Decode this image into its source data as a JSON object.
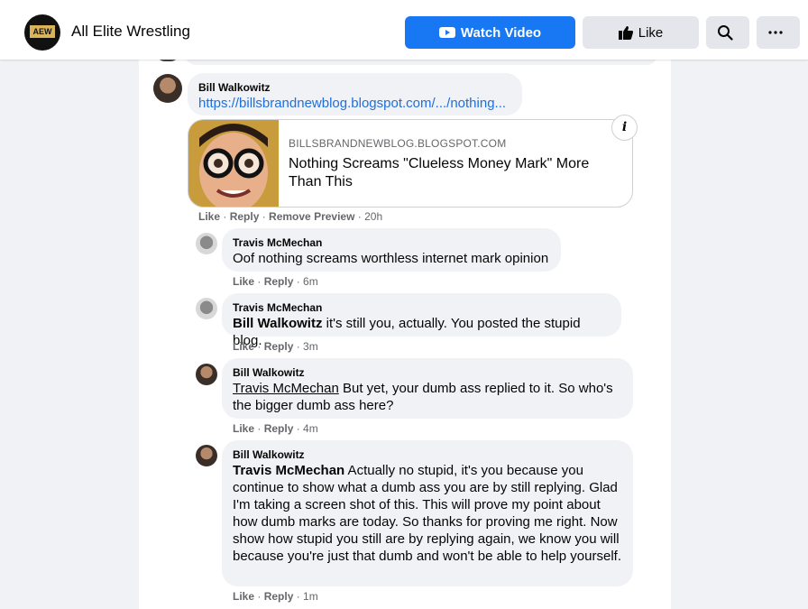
{
  "header": {
    "page_name": "All Elite Wrestling",
    "logo_text": "AEW",
    "watch_label": "Watch Video",
    "like_label": "Like",
    "icons": {
      "watch": "video-icon",
      "like": "thumbs-up-icon",
      "search": "search-icon",
      "more": "more-icon"
    }
  },
  "comments": [
    {
      "author": "Bill Walkowitz",
      "link": "https://billsbrandnewblog.blogspot.com/.../nothing...",
      "preview": {
        "domain": "BILLSBRANDNEWBLOG.BLOGSPOT.COM",
        "title": "Nothing Screams \"Clueless Money Mark\" More Than This"
      },
      "actions": {
        "like": "Like",
        "reply": "Reply",
        "remove": "Remove Preview",
        "time": "20h"
      }
    },
    {
      "author": "Travis McMechan",
      "text": "Oof nothing screams worthless internet mark opinion",
      "actions": {
        "like": "Like",
        "reply": "Reply",
        "time": "6m"
      }
    },
    {
      "author": "Travis McMechan",
      "mention": "Bill Walkowitz",
      "text": " it's still you, actually. You posted the stupid blog.",
      "actions": {
        "like": "Like",
        "reply": "Reply",
        "time": "3m"
      }
    },
    {
      "author": "Bill Walkowitz",
      "mention": "Travis McMechan",
      "text": " But yet, your dumb ass replied to it. So who's the bigger dumb ass here?",
      "actions": {
        "like": "Like",
        "reply": "Reply",
        "time": "4m"
      }
    },
    {
      "author": "Bill Walkowitz",
      "mention": "Travis McMechan",
      "text": " Actually no stupid, it's you because you continue to show what a dumb ass you are by still replying. Glad I'm taking a screen shot of this. This will prove my point about how dumb marks are today. So thanks for proving me right. Now show how stupid you still are by replying again, we know you will because you're just that dumb and won't be able to help yourself.",
      "actions": {
        "like": "Like",
        "reply": "Reply",
        "time": "1m"
      }
    }
  ],
  "colors": {
    "accent": "#1877f2",
    "link": "#216fdb",
    "bubble": "#f0f2f5",
    "meta": "#65676b"
  }
}
